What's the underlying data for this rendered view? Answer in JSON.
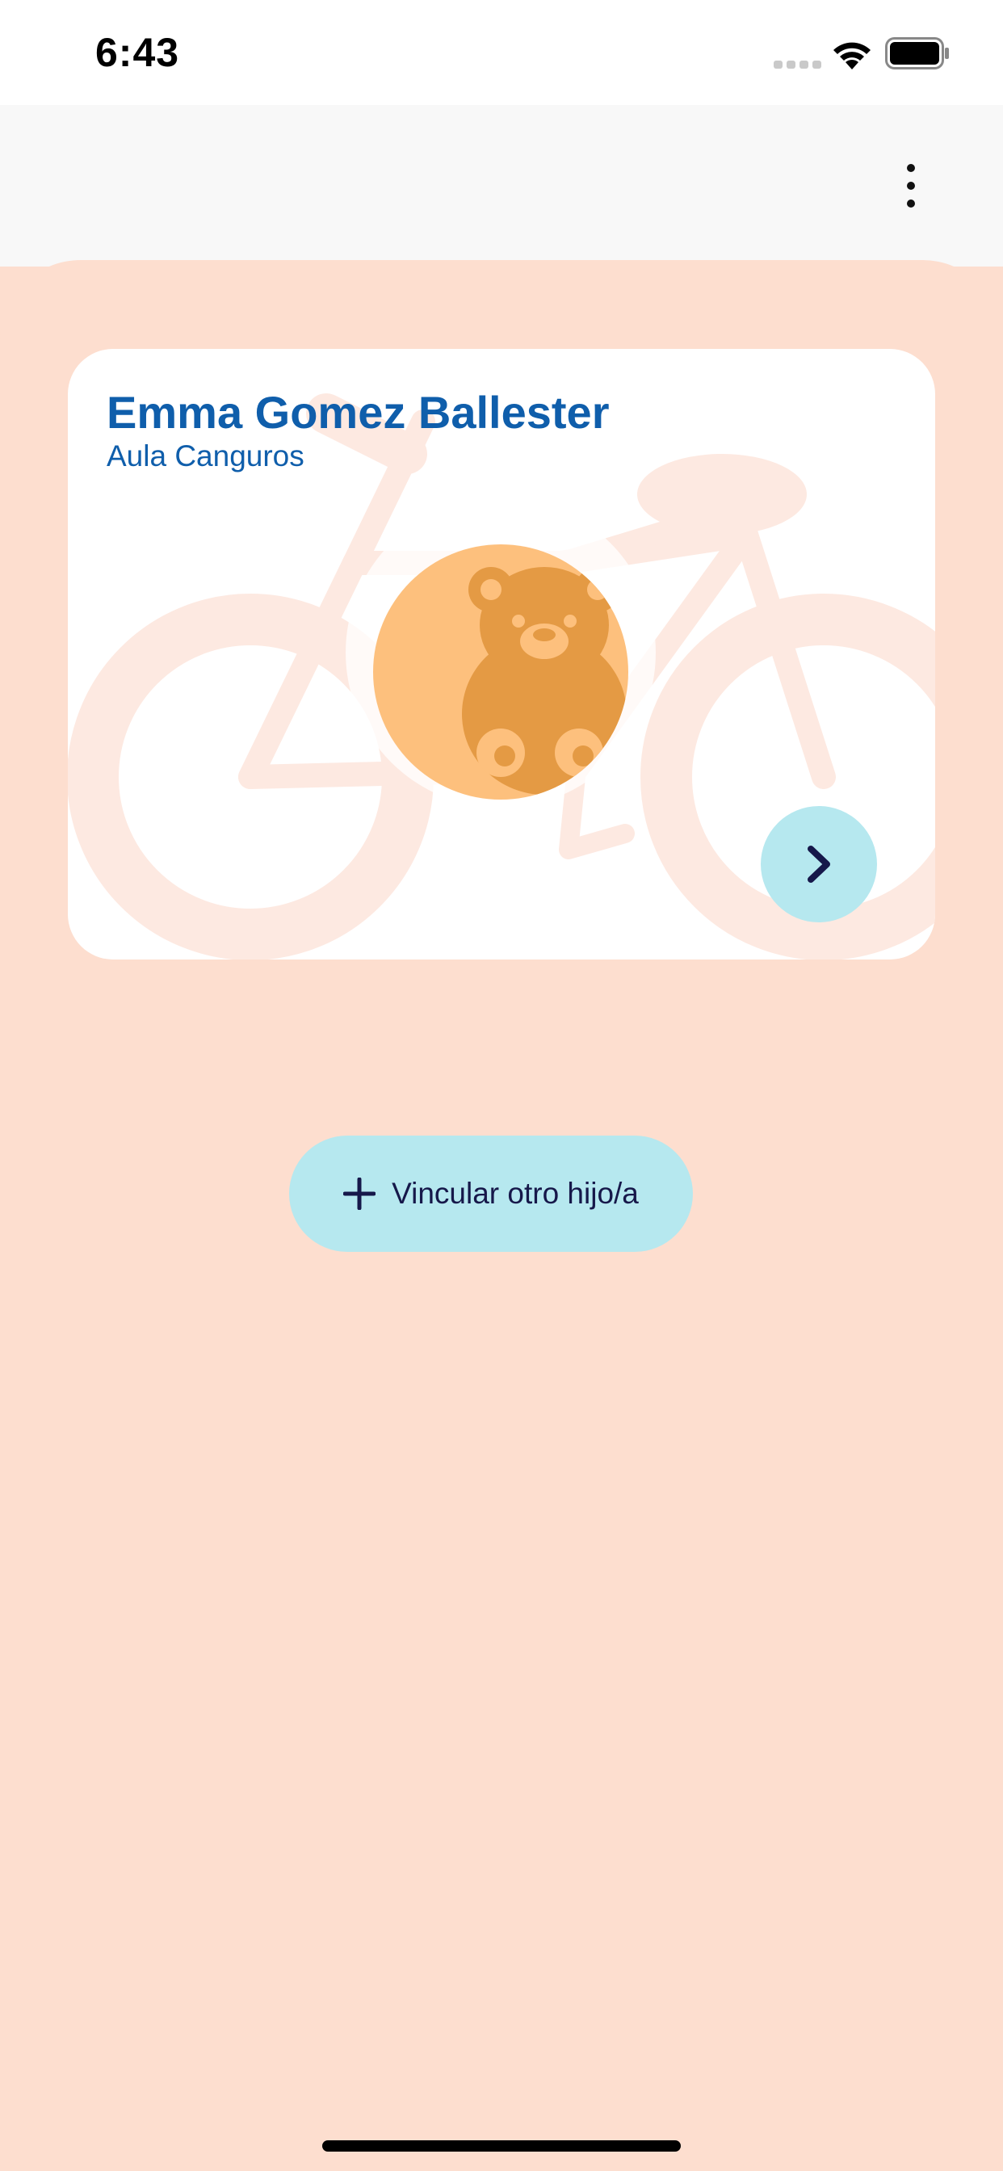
{
  "status_bar": {
    "time": "6:43"
  },
  "header": {
    "menu_icon": "more-vertical-icon"
  },
  "child_card": {
    "name": "Emma Gomez Ballester",
    "classroom": "Aula Canguros",
    "avatar_icon": "teddy-bear-icon",
    "background_icon": "bicycle-icon",
    "next_icon": "chevron-right-icon"
  },
  "link_button": {
    "label": "Vincular otro hijo/a",
    "icon": "plus-icon"
  },
  "colors": {
    "background": "#fddecf",
    "header_background": "#f8f8f8",
    "card_background": "#ffffff",
    "name_text": "#0f5eab",
    "accent_button": "#b6e8ef",
    "button_text": "#16184a",
    "avatar_background": "#fdc07d",
    "bear": "#e49a44"
  }
}
